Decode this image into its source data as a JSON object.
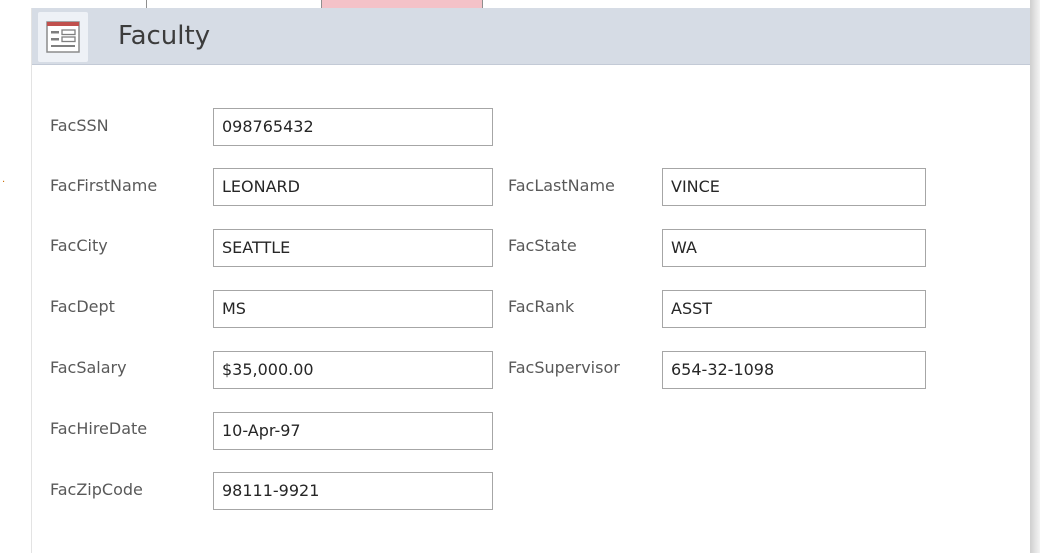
{
  "form": {
    "title": "Faculty",
    "icon": "form-icon"
  },
  "fields": {
    "fac_ssn": {
      "label": "FacSSN",
      "value": "098765432"
    },
    "fac_first_name": {
      "label": "FacFirstName",
      "value": "LEONARD"
    },
    "fac_last_name": {
      "label": "FacLastName",
      "value": "VINCE"
    },
    "fac_city": {
      "label": "FacCity",
      "value": "SEATTLE"
    },
    "fac_state": {
      "label": "FacState",
      "value": "WA"
    },
    "fac_dept": {
      "label": "FacDept",
      "value": "MS"
    },
    "fac_rank": {
      "label": "FacRank",
      "value": "ASST"
    },
    "fac_salary": {
      "label": "FacSalary",
      "value": "$35,000.00"
    },
    "fac_supervisor": {
      "label": "FacSupervisor",
      "value": "654-32-1098"
    },
    "fac_hire_date": {
      "label": "FacHireDate",
      "value": "10-Apr-97"
    },
    "fac_zip_code": {
      "label": "FacZipCode",
      "value": "98111-9921"
    }
  },
  "colors": {
    "header_bg": "#d6dce5",
    "active_tab": "#f4c2c8",
    "icon_accent": "#c0504d"
  }
}
